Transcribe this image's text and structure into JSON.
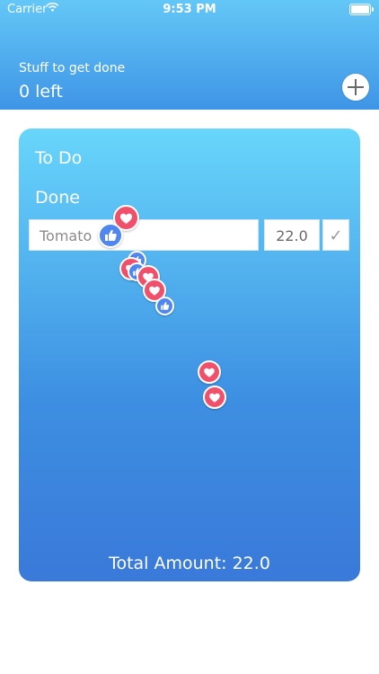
{
  "status_bar": {
    "carrier": "Carrier",
    "time": "9:53 PM"
  },
  "header": {
    "subtitle": "Stuff to get done",
    "count": "0 left"
  },
  "card": {
    "tabs": [
      "To Do",
      "Done"
    ],
    "item": {
      "name": "Tomato",
      "amount": "22.0"
    },
    "total": "Total Amount: 22.0"
  },
  "colors": {
    "header_top": "#63c7f6",
    "header_bottom": "#3f95e6",
    "card_top": "#68d6fb",
    "card_bottom": "#3a79d9",
    "heart": "#f0506a",
    "like": "#4f87ee"
  },
  "icons": [
    "wifi-icon",
    "battery-icon",
    "plus-icon",
    "check-icon",
    "heart-icon",
    "thumbs-up-icon"
  ]
}
